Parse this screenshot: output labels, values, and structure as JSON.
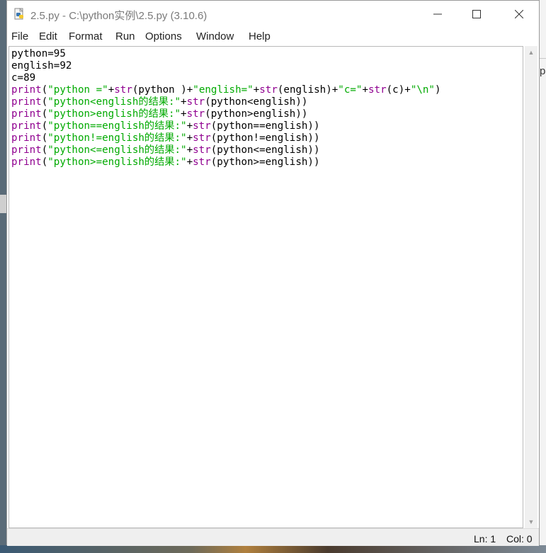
{
  "window": {
    "title": "2.5.py - C:\\python实例\\2.5.py (3.10.6)",
    "controls": {
      "minimize": "—",
      "maximize": "☐",
      "close": "✕"
    }
  },
  "menubar": {
    "items": [
      "File",
      "Edit",
      "Format",
      "Run",
      "Options",
      "Window",
      "Help"
    ]
  },
  "editor": {
    "lines": [
      [
        {
          "t": "python=95",
          "c": "plain"
        }
      ],
      [
        {
          "t": "english=92",
          "c": "plain"
        }
      ],
      [
        {
          "t": "c=89",
          "c": "plain"
        }
      ],
      [
        {
          "t": "print",
          "c": "kw"
        },
        {
          "t": "(",
          "c": "plain"
        },
        {
          "t": "\"python =\"",
          "c": "str"
        },
        {
          "t": "+",
          "c": "plain"
        },
        {
          "t": "str",
          "c": "kw"
        },
        {
          "t": "(python )+",
          "c": "plain"
        },
        {
          "t": "\"english=\"",
          "c": "str"
        },
        {
          "t": "+",
          "c": "plain"
        },
        {
          "t": "str",
          "c": "kw"
        },
        {
          "t": "(english)+",
          "c": "plain"
        },
        {
          "t": "\"c=\"",
          "c": "str"
        },
        {
          "t": "+",
          "c": "plain"
        },
        {
          "t": "str",
          "c": "kw"
        },
        {
          "t": "(c)+",
          "c": "plain"
        },
        {
          "t": "\"\\n\"",
          "c": "str"
        },
        {
          "t": ")",
          "c": "plain"
        }
      ],
      [
        {
          "t": "print",
          "c": "kw"
        },
        {
          "t": "(",
          "c": "plain"
        },
        {
          "t": "\"python<english的结果:\"",
          "c": "str"
        },
        {
          "t": "+",
          "c": "plain"
        },
        {
          "t": "str",
          "c": "kw"
        },
        {
          "t": "(python<english))",
          "c": "plain"
        }
      ],
      [
        {
          "t": "print",
          "c": "kw"
        },
        {
          "t": "(",
          "c": "plain"
        },
        {
          "t": "\"python>english的结果:\"",
          "c": "str"
        },
        {
          "t": "+",
          "c": "plain"
        },
        {
          "t": "str",
          "c": "kw"
        },
        {
          "t": "(python>english))",
          "c": "plain"
        }
      ],
      [
        {
          "t": "print",
          "c": "kw"
        },
        {
          "t": "(",
          "c": "plain"
        },
        {
          "t": "\"python==english的结果:\"",
          "c": "str"
        },
        {
          "t": "+",
          "c": "plain"
        },
        {
          "t": "str",
          "c": "kw"
        },
        {
          "t": "(python==english))",
          "c": "plain"
        }
      ],
      [
        {
          "t": "print",
          "c": "kw"
        },
        {
          "t": "(",
          "c": "plain"
        },
        {
          "t": "\"python!=english的结果:\"",
          "c": "str"
        },
        {
          "t": "+",
          "c": "plain"
        },
        {
          "t": "str",
          "c": "kw"
        },
        {
          "t": "(python!=english))",
          "c": "plain"
        }
      ],
      [
        {
          "t": "print",
          "c": "kw"
        },
        {
          "t": "(",
          "c": "plain"
        },
        {
          "t": "\"python<=english的结果:\"",
          "c": "str"
        },
        {
          "t": "+",
          "c": "plain"
        },
        {
          "t": "str",
          "c": "kw"
        },
        {
          "t": "(python<=english))",
          "c": "plain"
        }
      ],
      [
        {
          "t": "print",
          "c": "kw"
        },
        {
          "t": "(",
          "c": "plain"
        },
        {
          "t": "\"python>=english的结果:\"",
          "c": "str"
        },
        {
          "t": "+",
          "c": "plain"
        },
        {
          "t": "str",
          "c": "kw"
        },
        {
          "t": "(python>=english))",
          "c": "plain"
        }
      ]
    ]
  },
  "statusbar": {
    "line": "Ln: 1",
    "column": "Col: 0"
  },
  "background": {
    "window_fragment": "p"
  },
  "colors": {
    "keyword": "#900090",
    "string": "#00aa00",
    "plain": "#000000"
  }
}
